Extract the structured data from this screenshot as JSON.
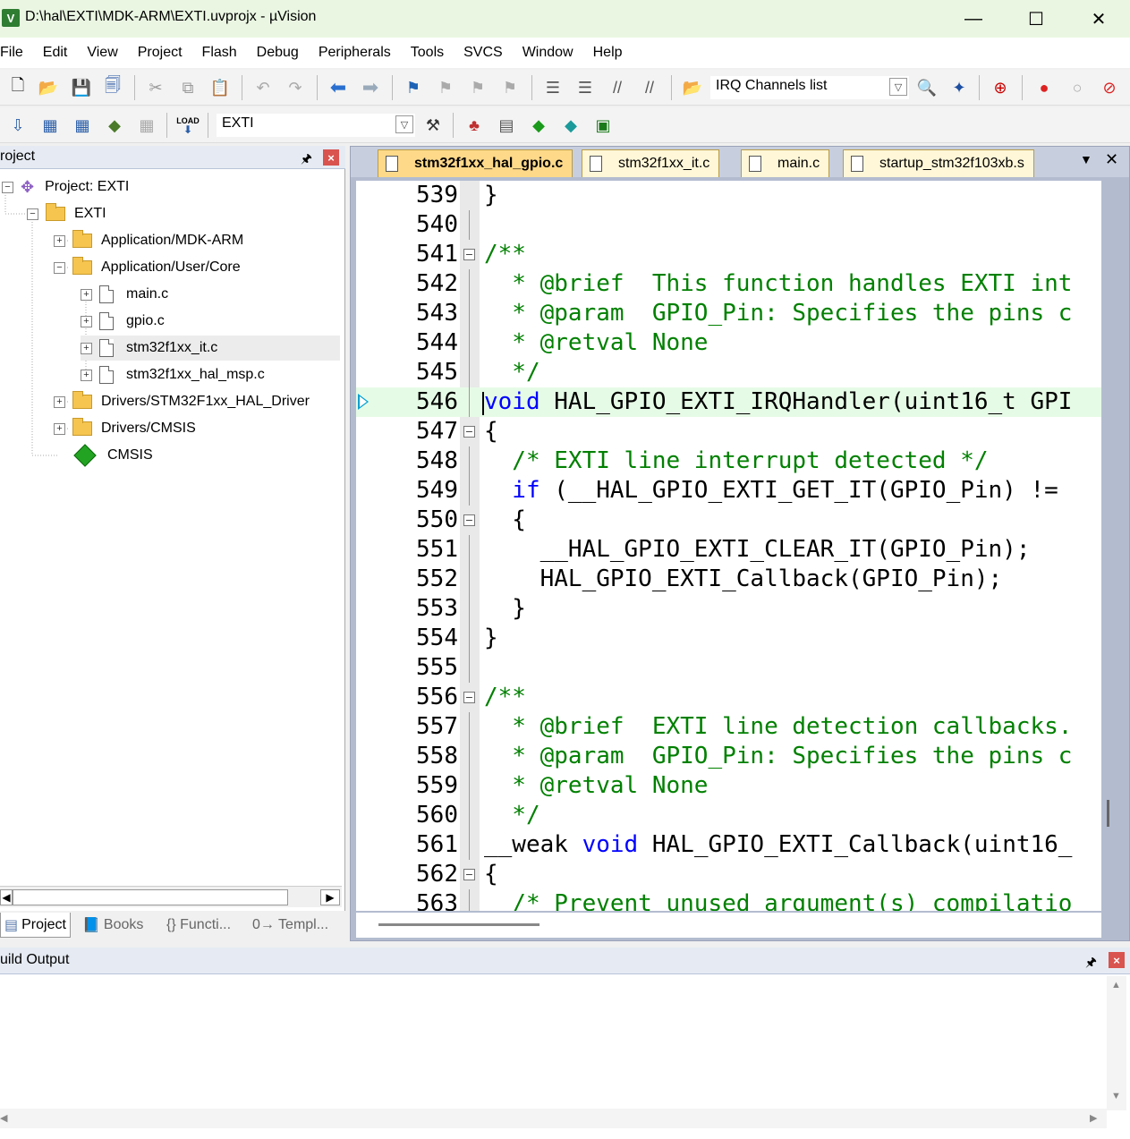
{
  "window": {
    "title": "D:\\hal\\EXTI\\MDK-ARM\\EXTI.uvprojx - µVision",
    "app_icon": "V",
    "minimize": "—",
    "maximize": "☐",
    "close": "✕"
  },
  "menu": [
    "File",
    "Edit",
    "View",
    "Project",
    "Flash",
    "Debug",
    "Peripherals",
    "Tools",
    "SVCS",
    "Window",
    "Help"
  ],
  "toolbar1": {
    "irq_combo": "IRQ Channels list"
  },
  "toolbar2": {
    "load_label": "LOAD",
    "target_combo": "EXTI"
  },
  "project_panel": {
    "title": "roject",
    "pin": "🖈",
    "close": "×",
    "tree": [
      {
        "label": "Project: EXTI",
        "toggle": "−"
      },
      {
        "label": "EXTI",
        "toggle": "−"
      },
      {
        "label": "Application/MDK-ARM",
        "toggle": "+"
      },
      {
        "label": "Application/User/Core",
        "toggle": "−"
      },
      {
        "label": "main.c",
        "toggle": "+"
      },
      {
        "label": "gpio.c",
        "toggle": "+"
      },
      {
        "label": "stm32f1xx_it.c",
        "toggle": "+"
      },
      {
        "label": "stm32f1xx_hal_msp.c",
        "toggle": "+"
      },
      {
        "label": "Drivers/STM32F1xx_HAL_Driver",
        "toggle": "+"
      },
      {
        "label": "Drivers/CMSIS",
        "toggle": "+"
      },
      {
        "label": "CMSIS",
        "toggle": ""
      }
    ],
    "bottom_tabs": [
      "Project",
      "Books",
      "{} Functi...",
      "0→ Templ..."
    ]
  },
  "editor": {
    "tabs": [
      "stm32f1xx_hal_gpio.c",
      "stm32f1xx_it.c",
      "main.c",
      "startup_stm32f103xb.s"
    ],
    "active_tab": 0,
    "tab_menu": "▼",
    "tab_close": "✕",
    "lines": [
      {
        "n": "539",
        "t": [
          [
            "",
            "}"
          ]
        ]
      },
      {
        "n": "540",
        "t": [
          [
            "",
            ""
          ]
        ]
      },
      {
        "n": "541",
        "t": [
          [
            "c",
            "/**"
          ]
        ]
      },
      {
        "n": "542",
        "t": [
          [
            "c",
            "  * @brief  This function handles EXTI int"
          ]
        ]
      },
      {
        "n": "543",
        "t": [
          [
            "c",
            "  * @param  GPIO_Pin: Specifies the pins c"
          ]
        ]
      },
      {
        "n": "544",
        "t": [
          [
            "c",
            "  * @retval None"
          ]
        ]
      },
      {
        "n": "545",
        "t": [
          [
            "c",
            "  */"
          ]
        ]
      },
      {
        "n": "546",
        "t": [
          [
            "k",
            "void"
          ],
          [
            "",
            " HAL_GPIO_EXTI_IRQHandler(uint16_t GPI"
          ]
        ]
      },
      {
        "n": "547",
        "t": [
          [
            "",
            "{"
          ]
        ]
      },
      {
        "n": "548",
        "t": [
          [
            "c",
            "  /* EXTI line interrupt detected */"
          ]
        ]
      },
      {
        "n": "549",
        "t": [
          [
            "k",
            "  if"
          ],
          [
            "",
            " (__HAL_GPIO_EXTI_GET_IT(GPIO_Pin) !="
          ]
        ]
      },
      {
        "n": "550",
        "t": [
          [
            "",
            "  {"
          ]
        ]
      },
      {
        "n": "551",
        "t": [
          [
            "",
            "    __HAL_GPIO_EXTI_CLEAR_IT(GPIO_Pin);"
          ]
        ]
      },
      {
        "n": "552",
        "t": [
          [
            "",
            "    HAL_GPIO_EXTI_Callback(GPIO_Pin);"
          ]
        ]
      },
      {
        "n": "553",
        "t": [
          [
            "",
            "  }"
          ]
        ]
      },
      {
        "n": "554",
        "t": [
          [
            "",
            "}"
          ]
        ]
      },
      {
        "n": "555",
        "t": [
          [
            "",
            ""
          ]
        ]
      },
      {
        "n": "556",
        "t": [
          [
            "c",
            "/**"
          ]
        ]
      },
      {
        "n": "557",
        "t": [
          [
            "c",
            "  * @brief  EXTI line detection callbacks."
          ]
        ]
      },
      {
        "n": "558",
        "t": [
          [
            "c",
            "  * @param  GPIO_Pin: Specifies the pins c"
          ]
        ]
      },
      {
        "n": "559",
        "t": [
          [
            "c",
            "  * @retval None"
          ]
        ]
      },
      {
        "n": "560",
        "t": [
          [
            "c",
            "  */"
          ]
        ]
      },
      {
        "n": "561",
        "t": [
          [
            "",
            "__weak "
          ],
          [
            "k",
            "void"
          ],
          [
            "",
            " HAL_GPIO_EXTI_Callback(uint16_"
          ]
        ]
      },
      {
        "n": "562",
        "t": [
          [
            "",
            "{"
          ]
        ]
      },
      {
        "n": "563",
        "t": [
          [
            "c",
            "  /* Prevent unused argument(s) compilatio"
          ]
        ]
      }
    ],
    "current_line": "546"
  },
  "build_output": {
    "title": "uild Output",
    "pin": "🖈",
    "close": "×"
  },
  "colors": {
    "comment": "#008000",
    "keyword": "#0000ff",
    "tab_active": "#ffd98a",
    "tab_inactive": "#fff7d8",
    "current_line": "#e6fbe6"
  }
}
